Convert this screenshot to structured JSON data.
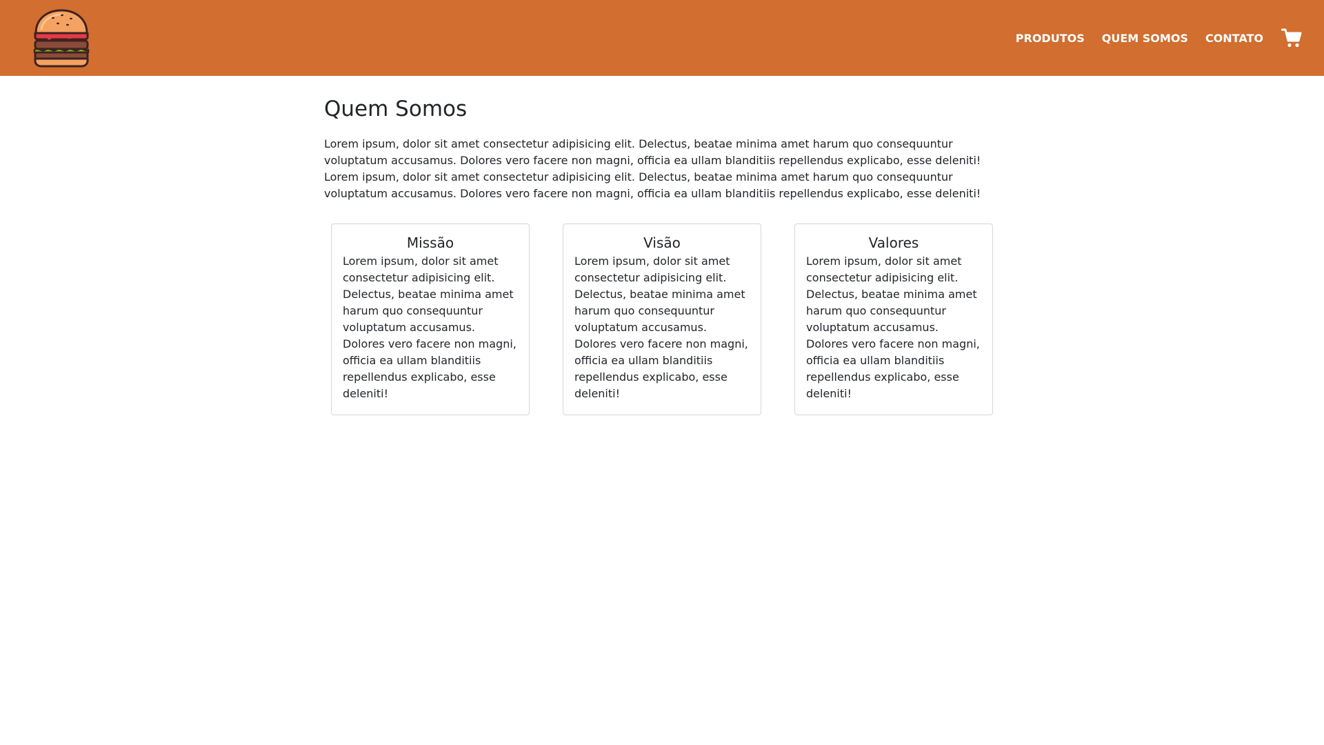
{
  "colors": {
    "header_bg": "#d26e2f",
    "nav_text": "#ffffff",
    "body_text": "#212529",
    "card_border": "#d6d6d6"
  },
  "header": {
    "logo_icon": "burger-icon",
    "nav": [
      {
        "label": "PRODUTOS"
      },
      {
        "label": "QUEM SOMOS"
      },
      {
        "label": "CONTATO"
      }
    ],
    "cart_icon": "cart-icon"
  },
  "main": {
    "title": "Quem Somos",
    "intro": "Lorem ipsum, dolor sit amet consectetur adipisicing elit. Delectus, beatae minima amet harum quo consequuntur voluptatum accusamus. Dolores vero facere non magni, officia ea ullam blanditiis repellendus explicabo, esse deleniti! Lorem ipsum, dolor sit amet consectetur adipisicing elit. Delectus, beatae minima amet harum quo consequuntur voluptatum accusamus. Dolores vero facere non magni, officia ea ullam blanditiis repellendus explicabo, esse deleniti!",
    "cards": [
      {
        "title": "Missão",
        "text": "Lorem ipsum, dolor sit amet consectetur adipisicing elit. Delectus, beatae minima amet harum quo consequuntur voluptatum accusamus. Dolores vero facere non magni, officia ea ullam blanditiis repellendus explicabo, esse deleniti!"
      },
      {
        "title": "Visão",
        "text": "Lorem ipsum, dolor sit amet consectetur adipisicing elit. Delectus, beatae minima amet harum quo consequuntur voluptatum accusamus. Dolores vero facere non magni, officia ea ullam blanditiis repellendus explicabo, esse deleniti!"
      },
      {
        "title": "Valores",
        "text": "Lorem ipsum, dolor sit amet consectetur adipisicing elit. Delectus, beatae minima amet harum quo consequuntur voluptatum accusamus. Dolores vero facere non magni, officia ea ullam blanditiis repellendus explicabo, esse deleniti!"
      }
    ]
  }
}
